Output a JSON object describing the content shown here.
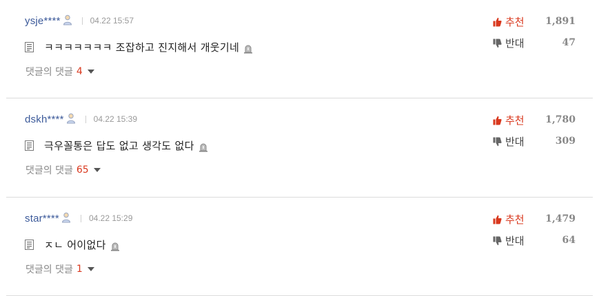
{
  "comments": [
    {
      "author": "ysje****",
      "date": "04.22 15:57",
      "text": "ㅋㅋㅋㅋㅋㅋㅋ 조잡하고 진지해서 개웃기네",
      "replies_label": "댓글의 댓글",
      "replies_count": "4",
      "up_label": "추천",
      "up_count": "1,891",
      "down_label": "반대",
      "down_count": "47"
    },
    {
      "author": "dskh****",
      "date": "04.22 15:39",
      "text": "극우꼴통은 답도 없고 생각도 없다",
      "replies_label": "댓글의 댓글",
      "replies_count": "65",
      "up_label": "추천",
      "up_count": "1,780",
      "down_label": "반대",
      "down_count": "309"
    },
    {
      "author": "star****",
      "date": "04.22 15:29",
      "text": "ㅈㄴ 어이없다",
      "replies_label": "댓글의 댓글",
      "replies_count": "1",
      "up_label": "추천",
      "up_count": "1,479",
      "down_label": "반대",
      "down_count": "64"
    }
  ],
  "colors": {
    "author": "#3c5a9a",
    "accent": "#d9381e",
    "muted": "#888888",
    "divider": "#dcdcdc"
  },
  "icons": {
    "user": "user-icon",
    "document": "document-icon",
    "report": "report-icon",
    "thumbs_up": "thumbs-up-icon",
    "thumbs_down": "thumbs-down-icon",
    "caret": "caret-down-icon"
  }
}
